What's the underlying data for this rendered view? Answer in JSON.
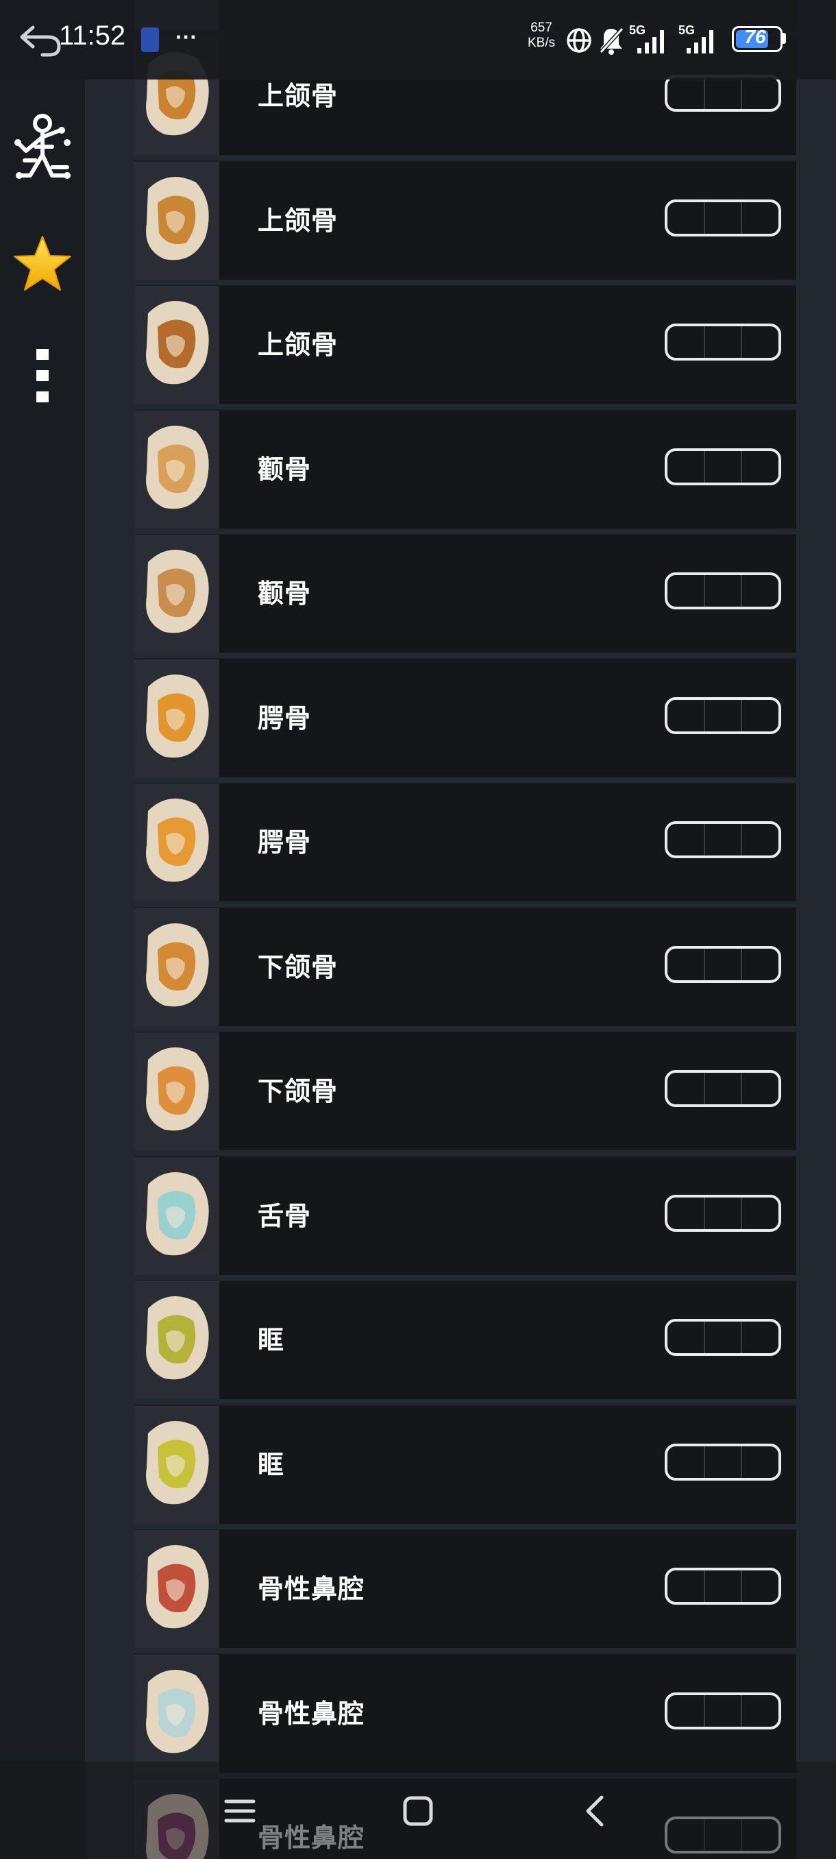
{
  "status_bar": {
    "time": "11:52",
    "net_speed_value": "657",
    "net_speed_unit": "KB/s",
    "network_1": "5G",
    "network_2": "5G",
    "battery": "76",
    "more_label": "···"
  },
  "sidebar": {
    "items": [
      {
        "icon": "anatomy-figure-icon"
      },
      {
        "icon": "star-icon"
      },
      {
        "icon": "more-vertical-icon"
      }
    ]
  },
  "list": {
    "items": [
      {
        "label": "上颌骨",
        "thumb_color": "#c9822f"
      },
      {
        "label": "上颌骨",
        "thumb_color": "#c98634"
      },
      {
        "label": "上颌骨",
        "thumb_color": "#b46b2c"
      },
      {
        "label": "颧骨",
        "thumb_color": "#d9a05a"
      },
      {
        "label": "颧骨",
        "thumb_color": "#c98d4e"
      },
      {
        "label": "腭骨",
        "thumb_color": "#e2942d"
      },
      {
        "label": "腭骨",
        "thumb_color": "#e69a34"
      },
      {
        "label": "下颌骨",
        "thumb_color": "#d28a34"
      },
      {
        "label": "下颌骨",
        "thumb_color": "#dd8f3c"
      },
      {
        "label": "舌骨",
        "thumb_color": "#9bd0d0"
      },
      {
        "label": "眶",
        "thumb_color": "#b5b23a"
      },
      {
        "label": "眶",
        "thumb_color": "#c6c33a"
      },
      {
        "label": "骨性鼻腔",
        "thumb_color": "#c0503a"
      },
      {
        "label": "骨性鼻腔",
        "thumb_color": "#b9d4d4"
      },
      {
        "label": "骨性鼻腔",
        "thumb_color": "#8a3f6e"
      }
    ]
  },
  "colors": {
    "background": "#1b1f25",
    "row_background": "#141619",
    "accent": "#3f8ef5",
    "star": "#f2c21b"
  }
}
